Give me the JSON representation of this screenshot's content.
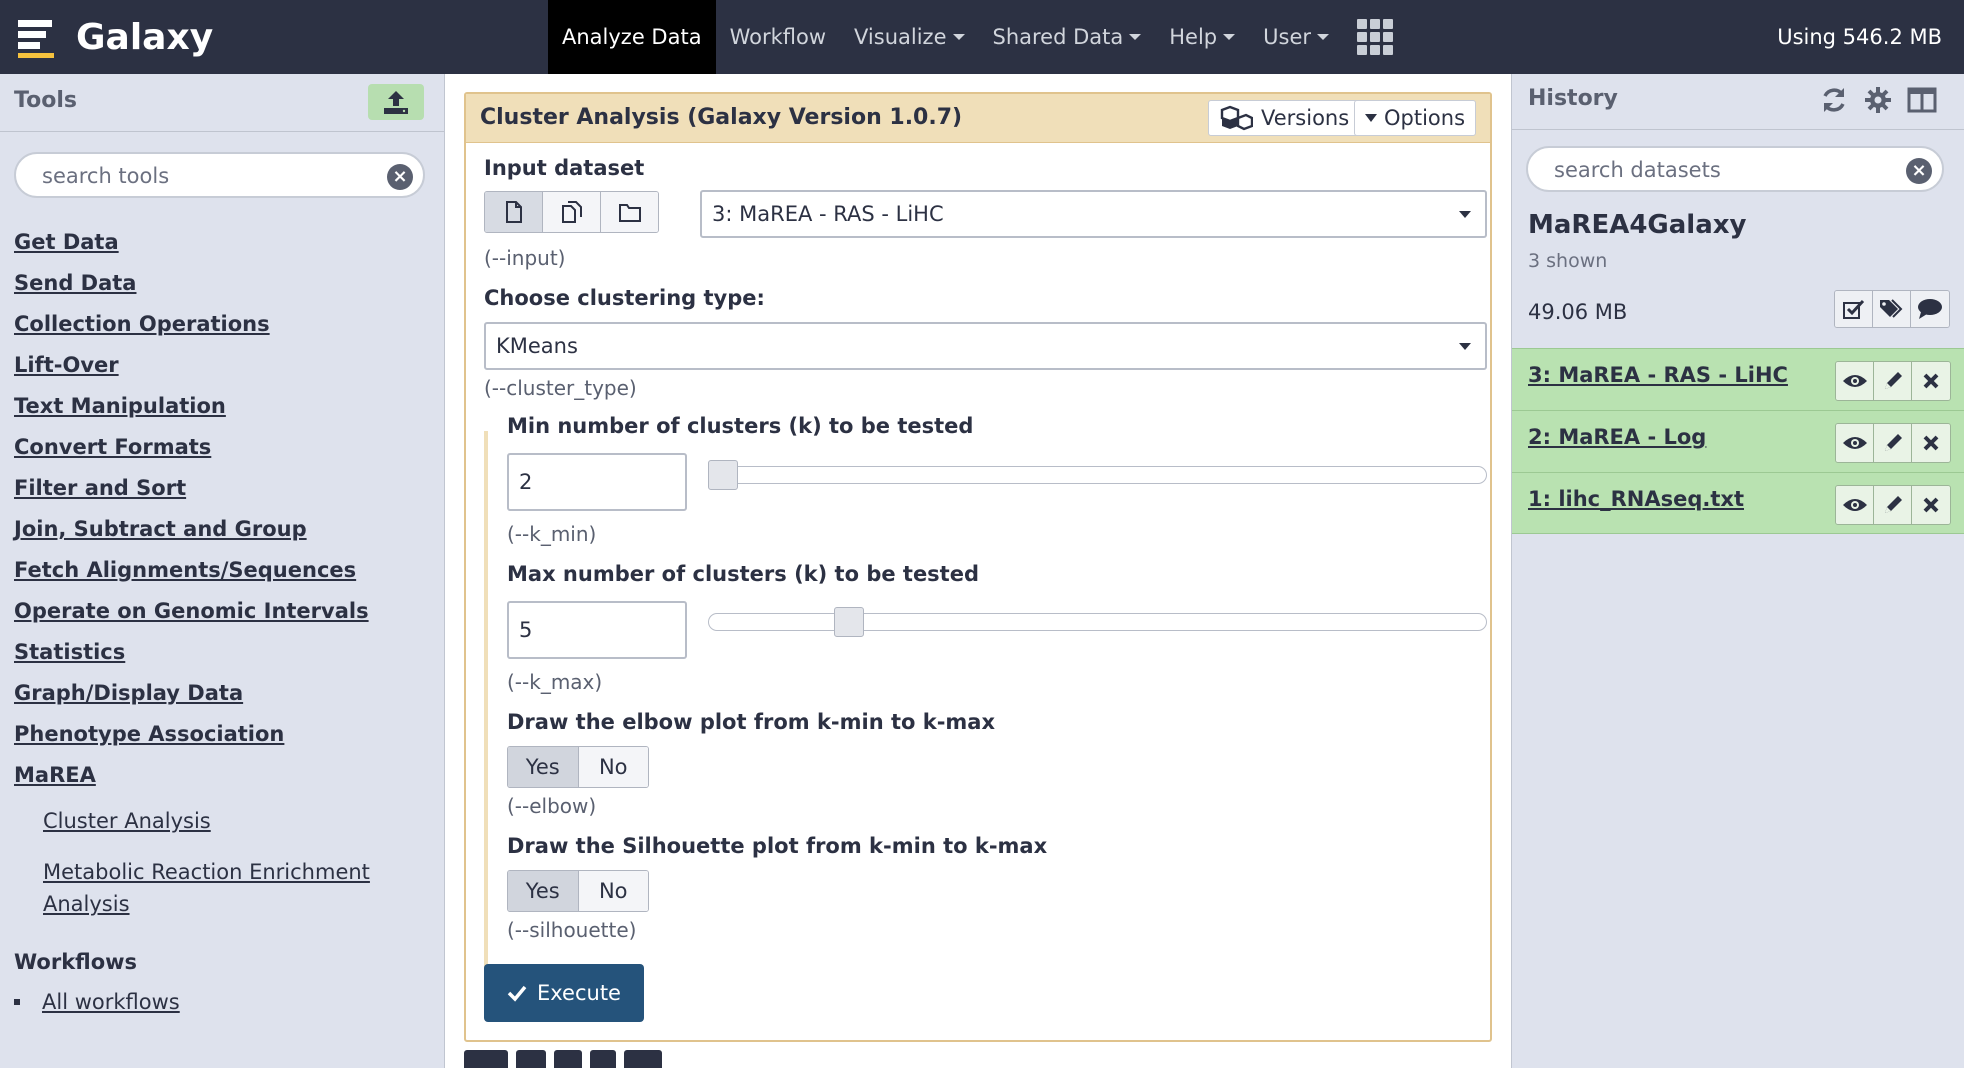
{
  "masthead": {
    "brand": "Galaxy",
    "nav": [
      {
        "label": "Analyze Data"
      },
      {
        "label": "Workflow"
      },
      {
        "label": "Visualize"
      },
      {
        "label": "Shared Data"
      },
      {
        "label": "Help"
      },
      {
        "label": "User"
      }
    ],
    "quota": "Using 546.2 MB"
  },
  "tools": {
    "title": "Tools",
    "search_placeholder": "search tools",
    "sections": [
      "Get Data",
      "Send Data",
      "Collection Operations",
      "Lift-Over",
      "Text Manipulation",
      "Convert Formats",
      "Filter and Sort",
      "Join, Subtract and Group",
      "Fetch Alignments/Sequences",
      "Operate on Genomic Intervals",
      "Statistics",
      "Graph/Display Data",
      "Phenotype Association",
      "MaREA"
    ],
    "marea_tools": [
      "Cluster Analysis",
      "Metabolic Reaction Enrichment",
      "Analysis"
    ],
    "workflows_title": "Workflows",
    "all_workflows": "All workflows"
  },
  "form": {
    "title": "Cluster Analysis (Galaxy Version 1.0.7)",
    "versions_label": "Versions",
    "options_label": "Options",
    "input_label": "Input dataset",
    "input_value": "3: MaREA - RAS - LiHC",
    "input_help": "(--input)",
    "cluster_label": "Choose clustering type:",
    "cluster_value": "KMeans",
    "cluster_help": "(--cluster_type)",
    "kmin_label": "Min number of clusters (k) to be tested",
    "kmin_value": "2",
    "kmin_help": "(--k_min)",
    "kmax_label": "Max number of clusters (k) to be tested",
    "kmax_value": "5",
    "kmax_help": "(--k_max)",
    "elbow_label": "Draw the elbow plot from k-min to k-max",
    "elbow_help": "(--elbow)",
    "silhouette_label": "Draw the Silhouette plot from k-min to k-max",
    "silhouette_help": "(--silhouette)",
    "yes_label": "Yes",
    "no_label": "No",
    "execute_label": "Execute"
  },
  "history": {
    "title": "History",
    "search_placeholder": "search datasets",
    "name": "MaREA4Galaxy",
    "shown": "3 shown",
    "size": "49.06 MB",
    "datasets": [
      {
        "title": "3: MaREA - RAS - LiHC"
      },
      {
        "title": "2: MaREA - Log"
      },
      {
        "title": "1: lihc_RNAseq.txt"
      }
    ]
  },
  "colors": {
    "masthead": "#2c3143",
    "panel": "#dee2ed",
    "dataset_ok": "#b9e2b1",
    "execute": "#25537b",
    "form_header": "#f0dfb9"
  }
}
